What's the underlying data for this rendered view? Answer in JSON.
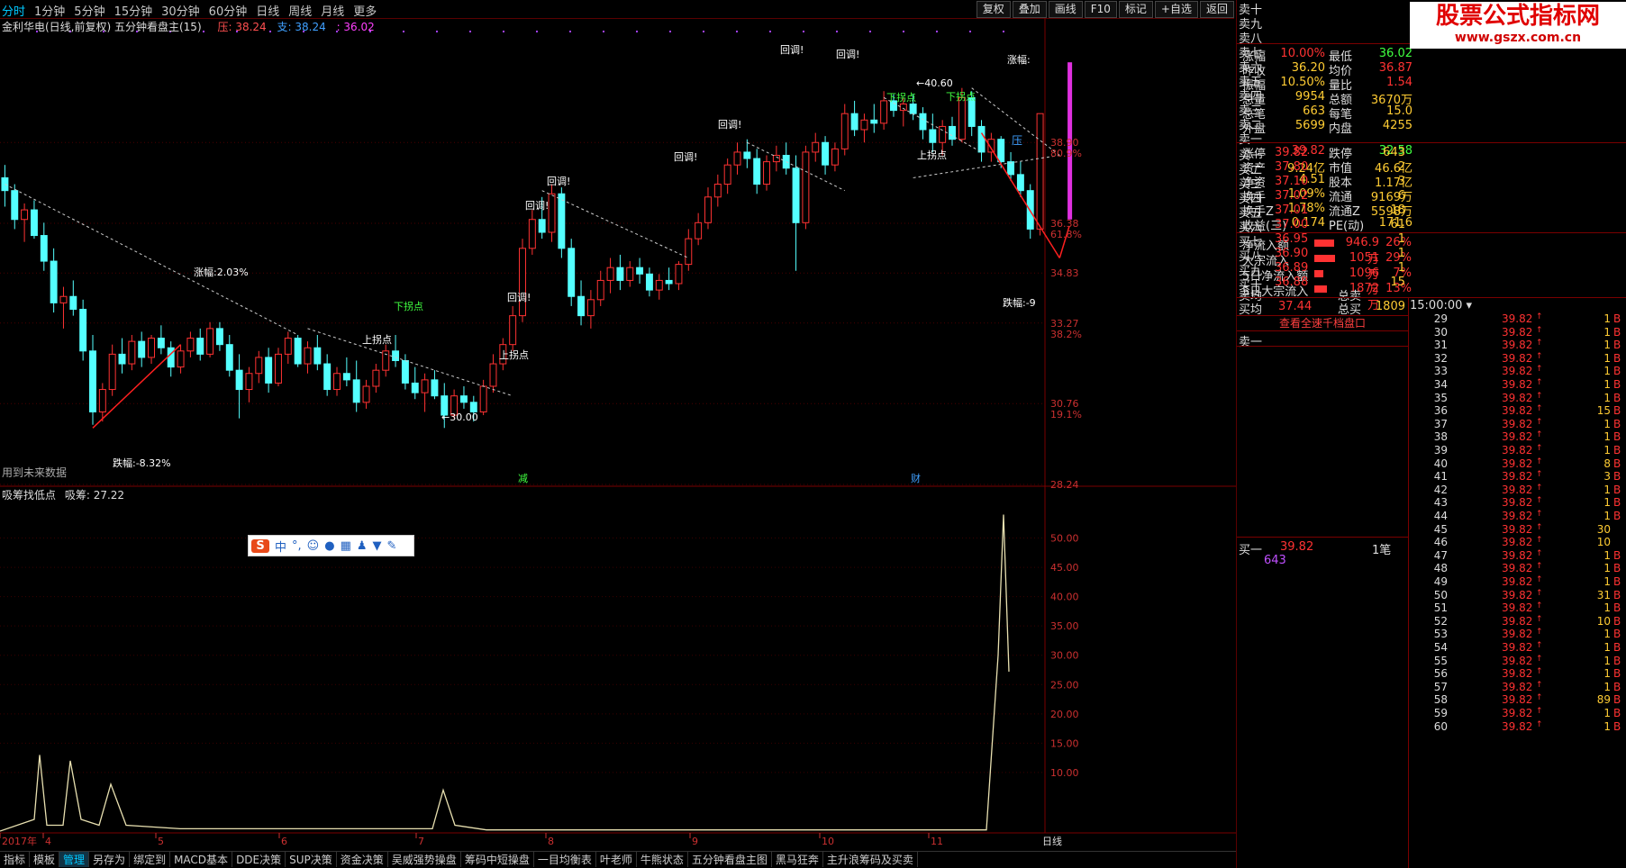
{
  "toolbar": {
    "periods": [
      "分时",
      "1分钟",
      "5分钟",
      "15分钟",
      "30分钟",
      "60分钟",
      "日线",
      "周线",
      "月线",
      "更多"
    ],
    "active_period": 0,
    "buttons": [
      "复权",
      "叠加",
      "画线",
      "F10",
      "标记",
      "+自选",
      "返回"
    ]
  },
  "main_chart": {
    "title": "金利华电(日线,前复权) 五分钟看盘主(15)",
    "ya_label": "压: 38.24",
    "zhi_label": "支: 38.24",
    "value_label": ": 36.02",
    "future_note": "用到未来数据",
    "right_axis": [
      {
        "price": "38.90",
        "pct": "80.9%"
      },
      {
        "price": "36.38",
        "pct": "61.8%"
      },
      {
        "price": "34.83",
        "pct": ""
      },
      {
        "price": "33.27",
        "pct": "38.2%"
      },
      {
        "price": "30.76",
        "pct": "19.1%"
      },
      {
        "price": "28.24",
        "pct": ""
      }
    ],
    "annotations": {
      "zhangfu_left": "涨幅:2.03%",
      "diefu_left": "跌幅:-8.32%",
      "low_marker": "←30.00",
      "high_marker": "←40.60",
      "zhangfu_right": "涨幅:",
      "diefu_right": "跌幅:-9",
      "callbacks": [
        "回调!",
        "回调!",
        "回调!",
        "回调!",
        "回调!",
        "回调!",
        "回调!"
      ],
      "up_turn": [
        "上拐点",
        "上拐点",
        "上拐点"
      ],
      "down_turn": [
        "下拐点",
        "下拐点",
        "下拐点"
      ],
      "ya_badge": "压",
      "jian": "减",
      "cai": "财"
    }
  },
  "sub_chart": {
    "title": "吸筹找低点",
    "value_label": "吸筹: 27.22",
    "axis": [
      "50.00",
      "45.00",
      "40.00",
      "35.00",
      "30.00",
      "25.00",
      "20.00",
      "15.00",
      "10.00"
    ]
  },
  "time_axis": [
    "2017年",
    "4",
    "5",
    "6",
    "7",
    "8",
    "9",
    "10",
    "11"
  ],
  "time_axis_right": "日线",
  "bottom_tabs": [
    "指标",
    "模板",
    "管理",
    "另存为",
    "绑定到",
    "MACD基本",
    "DDE决策",
    "SUP决策",
    "资金决策",
    "吴威强势操盘",
    "筹码中短操盘",
    "一目均衡表",
    "叶老师",
    "牛熊状态",
    "五分钟看盘主图",
    "黑马狂奔",
    "主升浪筹码及买卖"
  ],
  "active_bottom_tab": 2,
  "order_book": {
    "sells": [
      "卖十",
      "卖九",
      "卖八",
      "卖七",
      "卖六",
      "卖五",
      "卖四",
      "卖三",
      "卖二",
      "卖一"
    ],
    "buys": [
      {
        "name": "买一",
        "price": "39.82",
        "vol": "643"
      },
      {
        "name": "买二",
        "price": "37.80",
        "vol": "2"
      },
      {
        "name": "买三",
        "price": "37.10",
        "vol": "3"
      },
      {
        "name": "买四",
        "price": "37.02",
        "vol": "6"
      },
      {
        "name": "买五",
        "price": "37.01",
        "vol": "18"
      },
      {
        "name": "买六",
        "price": "37.00",
        "vol": "61"
      },
      {
        "name": "买七",
        "price": "36.95",
        "vol": "1"
      },
      {
        "name": "买八",
        "price": "36.90",
        "vol": "1"
      },
      {
        "name": "买九",
        "price": "36.89",
        "vol": "1"
      },
      {
        "name": "买十",
        "price": "36.88",
        "vol": "15"
      }
    ],
    "avg_sell_label": "卖均",
    "total_sell_label": "总卖",
    "avg_buy_label": "买均",
    "avg_buy": "37.44",
    "total_buy_label": "总买",
    "total_buy": "1809",
    "view_all": "查看全速千档盘口",
    "sell1_label": "卖一",
    "buy1_label": "买一",
    "buy1_price": "39.82",
    "buy1_unit": "1笔",
    "buy1_vol": "643"
  },
  "quote": {
    "watermark_title": "股票公式指标网",
    "watermark_url": "www.gszx.com.cn",
    "rows": [
      {
        "l": "涨幅",
        "lv": "10.00%",
        "r": "最低",
        "rv": "36.02"
      },
      {
        "l": "昨收",
        "lv": "36.20",
        "r": "均价",
        "rv": "36.87"
      },
      {
        "l": "振幅",
        "lv": "10.50%",
        "r": "量比",
        "rv": "1.54"
      },
      {
        "l": "总量",
        "lv": "9954",
        "r": "总额",
        "rv": "3670万"
      },
      {
        "l": "总笔",
        "lv": "663",
        "r": "每笔",
        "rv": "15.0"
      },
      {
        "l": "外盘",
        "lv": "5699",
        "r": "内盘",
        "rv": "4255"
      },
      {
        "l": "涨停",
        "lv": "39.82",
        "r": "跌停",
        "rv": "32.58"
      },
      {
        "l": "资产",
        "lv": "9.24亿",
        "r": "市值",
        "rv": "46.6亿"
      },
      {
        "l": "净资",
        "lv": "4.51",
        "r": "股本",
        "rv": "1.17亿"
      },
      {
        "l": "换手",
        "lv": "1.09%",
        "r": "流通",
        "rv": "9169万"
      },
      {
        "l": "换手Z",
        "lv": "1.78%",
        "r": "流通Z",
        "rv": "5598万"
      },
      {
        "l": "收益(三)",
        "lv": "0.174",
        "r": "PE(动)",
        "rv": "171.6"
      }
    ],
    "flows": [
      {
        "l": "净流入额",
        "v": "946.9万",
        "p": "26%",
        "bar": 0.26
      },
      {
        "l": "大宗流入",
        "v": "1051万",
        "p": "29%",
        "bar": 0.29
      },
      {
        "l": "5日净流入额",
        "v": "1096万",
        "p": "7%",
        "bar": 0.07
      },
      {
        "l": "5日大宗流入",
        "v": "1872万",
        "p": "13%",
        "bar": 0.13
      }
    ]
  },
  "ticks": {
    "header": "15:00:00",
    "rows": [
      {
        "m": "29",
        "p": "39.82",
        "v": "1",
        "t": "B"
      },
      {
        "m": "30",
        "p": "39.82",
        "v": "1",
        "t": "B"
      },
      {
        "m": "31",
        "p": "39.82",
        "v": "1",
        "t": "B"
      },
      {
        "m": "32",
        "p": "39.82",
        "v": "1",
        "t": "B"
      },
      {
        "m": "33",
        "p": "39.82",
        "v": "1",
        "t": "B"
      },
      {
        "m": "34",
        "p": "39.82",
        "v": "1",
        "t": "B"
      },
      {
        "m": "35",
        "p": "39.82",
        "v": "1",
        "t": "B"
      },
      {
        "m": "36",
        "p": "39.82",
        "v": "15",
        "t": "B"
      },
      {
        "m": "37",
        "p": "39.82",
        "v": "1",
        "t": "B"
      },
      {
        "m": "38",
        "p": "39.82",
        "v": "1",
        "t": "B"
      },
      {
        "m": "39",
        "p": "39.82",
        "v": "1",
        "t": "B"
      },
      {
        "m": "40",
        "p": "39.82",
        "v": "8",
        "t": "B"
      },
      {
        "m": "41",
        "p": "39.82",
        "v": "3",
        "t": "B"
      },
      {
        "m": "42",
        "p": "39.82",
        "v": "1",
        "t": "B"
      },
      {
        "m": "43",
        "p": "39.82",
        "v": "1",
        "t": "B"
      },
      {
        "m": "44",
        "p": "39.82",
        "v": "1",
        "t": "B"
      },
      {
        "m": "45",
        "p": "39.82",
        "v": "30",
        "t": ""
      },
      {
        "m": "46",
        "p": "39.82",
        "v": "10",
        "t": ""
      },
      {
        "m": "47",
        "p": "39.82",
        "v": "1",
        "t": "B"
      },
      {
        "m": "48",
        "p": "39.82",
        "v": "1",
        "t": "B"
      },
      {
        "m": "49",
        "p": "39.82",
        "v": "1",
        "t": "B"
      },
      {
        "m": "50",
        "p": "39.82",
        "v": "31",
        "t": "B"
      },
      {
        "m": "51",
        "p": "39.82",
        "v": "1",
        "t": "B"
      },
      {
        "m": "52",
        "p": "39.82",
        "v": "10",
        "t": "B"
      },
      {
        "m": "53",
        "p": "39.82",
        "v": "1",
        "t": "B"
      },
      {
        "m": "54",
        "p": "39.82",
        "v": "1",
        "t": "B"
      },
      {
        "m": "55",
        "p": "39.82",
        "v": "1",
        "t": "B"
      },
      {
        "m": "56",
        "p": "39.82",
        "v": "1",
        "t": "B"
      },
      {
        "m": "57",
        "p": "39.82",
        "v": "1",
        "t": "B"
      },
      {
        "m": "58",
        "p": "39.82",
        "v": "89",
        "t": "B"
      },
      {
        "m": "59",
        "p": "39.82",
        "v": "1",
        "t": "B"
      },
      {
        "m": "60",
        "p": "39.82",
        "v": "1",
        "t": "B"
      }
    ]
  },
  "chart_data": {
    "type": "candlestick",
    "candles": [
      [
        37.8,
        38.2,
        36.9,
        37.4
      ],
      [
        37.4,
        37.6,
        36.2,
        36.5
      ],
      [
        36.5,
        37.0,
        35.8,
        36.8
      ],
      [
        36.8,
        37.1,
        35.9,
        36.0
      ],
      [
        36.0,
        36.4,
        34.9,
        35.2
      ],
      [
        35.2,
        35.6,
        33.6,
        33.9
      ],
      [
        33.9,
        34.4,
        33.1,
        34.1
      ],
      [
        34.1,
        34.6,
        33.5,
        33.7
      ],
      [
        33.7,
        34.0,
        32.1,
        32.4
      ],
      [
        32.4,
        32.9,
        30.1,
        30.5
      ],
      [
        30.5,
        31.4,
        30.2,
        31.2
      ],
      [
        31.2,
        32.6,
        31.0,
        32.3
      ],
      [
        32.3,
        32.8,
        31.7,
        32.0
      ],
      [
        32.0,
        32.9,
        31.8,
        32.7
      ],
      [
        32.7,
        33.0,
        31.9,
        32.2
      ],
      [
        32.2,
        32.9,
        32.0,
        32.8
      ],
      [
        32.8,
        33.2,
        32.3,
        32.5
      ],
      [
        32.5,
        32.7,
        31.6,
        31.9
      ],
      [
        31.9,
        32.6,
        31.7,
        32.4
      ],
      [
        32.4,
        33.0,
        32.2,
        32.8
      ],
      [
        32.8,
        33.1,
        32.1,
        32.3
      ],
      [
        32.3,
        33.3,
        32.2,
        33.1
      ],
      [
        33.1,
        33.3,
        32.4,
        32.6
      ],
      [
        32.6,
        32.9,
        31.6,
        31.8
      ],
      [
        31.8,
        32.3,
        30.3,
        31.2
      ],
      [
        31.2,
        31.9,
        30.8,
        31.7
      ],
      [
        31.7,
        32.4,
        31.4,
        32.2
      ],
      [
        32.2,
        32.5,
        31.1,
        31.4
      ],
      [
        31.4,
        32.5,
        31.3,
        32.3
      ],
      [
        32.3,
        33.0,
        32.0,
        32.8
      ],
      [
        32.8,
        32.9,
        31.9,
        32.0
      ],
      [
        32.0,
        32.7,
        31.7,
        32.5
      ],
      [
        32.5,
        32.9,
        31.8,
        32.0
      ],
      [
        32.0,
        32.3,
        31.0,
        31.2
      ],
      [
        31.2,
        31.9,
        31.0,
        31.7
      ],
      [
        31.7,
        32.2,
        31.3,
        31.5
      ],
      [
        31.5,
        32.1,
        30.5,
        30.8
      ],
      [
        30.8,
        31.5,
        30.6,
        31.3
      ],
      [
        31.3,
        32.0,
        31.1,
        31.8
      ],
      [
        31.8,
        32.6,
        31.6,
        32.4
      ],
      [
        32.4,
        32.9,
        31.9,
        32.1
      ],
      [
        32.1,
        32.3,
        31.2,
        31.4
      ],
      [
        31.4,
        31.9,
        30.9,
        31.1
      ],
      [
        31.1,
        31.7,
        30.5,
        31.5
      ],
      [
        31.5,
        31.8,
        30.9,
        31.0
      ],
      [
        31.0,
        31.4,
        30.0,
        30.4
      ],
      [
        30.4,
        31.2,
        30.3,
        31.0
      ],
      [
        31.0,
        31.3,
        30.6,
        30.8
      ],
      [
        30.8,
        31.0,
        30.2,
        30.5
      ],
      [
        30.5,
        31.5,
        30.4,
        31.3
      ],
      [
        31.3,
        32.3,
        31.1,
        32.0
      ],
      [
        32.0,
        32.8,
        31.8,
        32.6
      ],
      [
        32.6,
        33.8,
        32.4,
        33.5
      ],
      [
        33.5,
        35.9,
        33.3,
        35.6
      ],
      [
        35.6,
        36.8,
        35.4,
        36.5
      ],
      [
        36.5,
        37.2,
        35.9,
        36.1
      ],
      [
        36.1,
        37.6,
        35.8,
        37.3
      ],
      [
        37.3,
        37.5,
        35.3,
        35.6
      ],
      [
        35.6,
        35.9,
        33.8,
        34.1
      ],
      [
        34.1,
        34.6,
        33.2,
        33.5
      ],
      [
        33.5,
        34.3,
        33.1,
        34.0
      ],
      [
        34.0,
        34.9,
        33.8,
        34.6
      ],
      [
        34.6,
        35.3,
        34.2,
        35.0
      ],
      [
        35.0,
        35.4,
        34.3,
        34.6
      ],
      [
        34.6,
        35.2,
        34.4,
        35.0
      ],
      [
        35.0,
        35.3,
        34.5,
        34.8
      ],
      [
        34.8,
        35.0,
        34.1,
        34.3
      ],
      [
        34.3,
        34.8,
        34.0,
        34.6
      ],
      [
        34.6,
        35.0,
        34.3,
        34.5
      ],
      [
        34.5,
        35.2,
        34.3,
        35.1
      ],
      [
        35.1,
        36.2,
        34.9,
        35.9
      ],
      [
        35.9,
        36.7,
        35.7,
        36.4
      ],
      [
        36.4,
        37.5,
        36.2,
        37.2
      ],
      [
        37.2,
        37.9,
        36.9,
        37.6
      ],
      [
        37.6,
        38.4,
        37.3,
        38.2
      ],
      [
        38.2,
        38.9,
        37.9,
        38.6
      ],
      [
        38.6,
        39.0,
        38.1,
        38.4
      ],
      [
        38.4,
        38.7,
        37.3,
        37.6
      ],
      [
        37.6,
        38.5,
        37.4,
        38.3
      ],
      [
        38.3,
        38.8,
        38.0,
        38.5
      ],
      [
        38.5,
        38.9,
        37.9,
        38.1
      ],
      [
        38.1,
        38.5,
        34.9,
        36.4
      ],
      [
        36.4,
        38.8,
        36.2,
        38.6
      ],
      [
        38.6,
        39.2,
        38.3,
        38.9
      ],
      [
        38.9,
        39.1,
        37.9,
        38.2
      ],
      [
        38.2,
        38.9,
        38.0,
        38.7
      ],
      [
        38.7,
        40.1,
        38.5,
        39.8
      ],
      [
        39.8,
        40.2,
        39.1,
        39.3
      ],
      [
        39.3,
        39.8,
        38.9,
        39.6
      ],
      [
        39.6,
        40.1,
        39.2,
        39.5
      ],
      [
        39.5,
        40.5,
        39.3,
        40.2
      ],
      [
        40.2,
        40.4,
        39.7,
        39.9
      ],
      [
        39.9,
        40.3,
        39.4,
        40.1
      ],
      [
        40.1,
        40.4,
        39.6,
        39.8
      ],
      [
        39.8,
        40.0,
        39.0,
        39.3
      ],
      [
        39.3,
        39.8,
        38.6,
        38.9
      ],
      [
        38.9,
        39.6,
        38.5,
        39.4
      ],
      [
        39.4,
        39.7,
        38.8,
        39.0
      ],
      [
        39.0,
        40.6,
        38.9,
        40.3
      ],
      [
        40.3,
        40.5,
        39.1,
        39.4
      ],
      [
        39.4,
        39.6,
        38.3,
        38.6
      ],
      [
        38.6,
        39.2,
        38.3,
        39.0
      ],
      [
        39.0,
        39.1,
        38.1,
        38.3
      ],
      [
        38.3,
        38.6,
        37.7,
        37.9
      ],
      [
        37.9,
        38.3,
        37.2,
        37.4
      ],
      [
        37.4,
        37.6,
        35.9,
        36.2
      ],
      [
        36.2,
        39.8,
        36.0,
        39.8
      ]
    ],
    "ylim": [
      28.24,
      42.5
    ],
    "sub_series": {
      "name": "吸筹",
      "ylim": [
        0,
        55
      ]
    }
  }
}
